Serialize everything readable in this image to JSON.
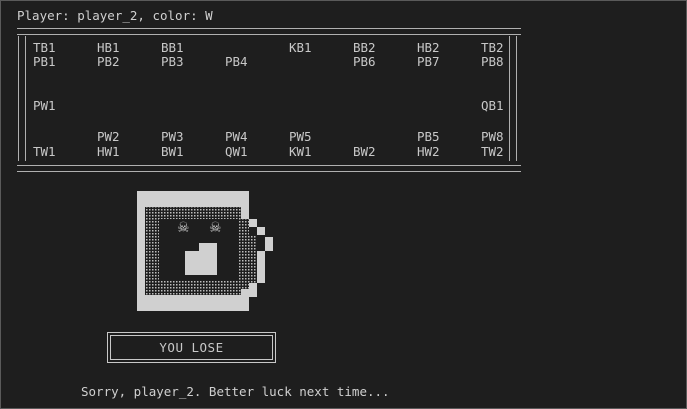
{
  "header": {
    "player_label": "Player: player_2, color: W"
  },
  "board": {
    "rows": [
      [
        "TB1",
        "HB1",
        "BB1",
        "",
        "KB1",
        "BB2",
        "HB2",
        "TB2"
      ],
      [
        "PB1",
        "PB2",
        "PB3",
        "PB4",
        "",
        "PB6",
        "PB7",
        "PB8"
      ],
      [
        "",
        "",
        "",
        "",
        "",
        "",
        "",
        ""
      ],
      [
        "",
        "",
        "",
        "",
        "",
        "",
        "",
        ""
      ],
      [
        "PW1",
        "",
        "",
        "",
        "",
        "",
        "",
        "QB1"
      ],
      [
        "",
        "",
        "",
        "",
        "",
        "",
        "",
        ""
      ],
      [
        "",
        "PW2",
        "PW3",
        "PW4",
        "PW5",
        "",
        "PB5",
        "PW8"
      ],
      [
        "TW1",
        "HW1",
        "BW1",
        "QW1",
        "KW1",
        "BW2",
        "HW2",
        "TW2"
      ]
    ]
  },
  "result": {
    "banner": "YOU LOSE",
    "message": "Sorry, player_2. Better luck next time..."
  },
  "art": {
    "name": "skull-mug-icon",
    "colors": {
      "light": "#d0d0d0",
      "dark": "#1e1e1e"
    }
  }
}
